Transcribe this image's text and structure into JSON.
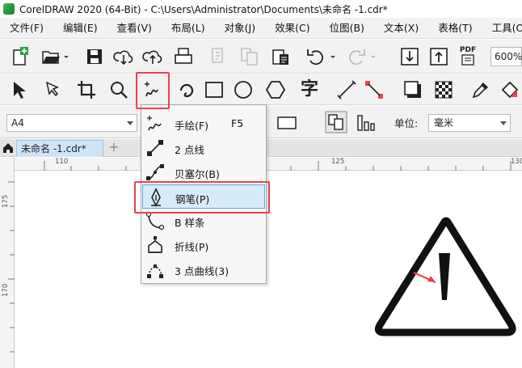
{
  "window": {
    "title": "CorelDRAW 2020 (64-Bit) - C:\\Users\\Administrator\\Documents\\未命名 -1.cdr*"
  },
  "menu": [
    "文件(F)",
    "编辑(E)",
    "查看(V)",
    "布局(L)",
    "对象(J)",
    "效果(C)",
    "位图(B)",
    "文本(X)",
    "表格(T)",
    "工具(O)"
  ],
  "toolbar": {
    "zoom": "600%",
    "pdf_label": "PDF"
  },
  "toolbox": {
    "text_tool_glyph": "字"
  },
  "property_bar": {
    "page_size": "A4",
    "unit_label": "单位:",
    "unit_value": "毫米"
  },
  "tabs": {
    "doc_tab": "未命名 -1.cdr*",
    "add_tab": "+"
  },
  "ruler": {
    "h_labels": [
      "110",
      "125",
      "130"
    ],
    "v_labels": [
      "175",
      "170"
    ]
  },
  "curve_flyout": {
    "items": [
      {
        "label": "手绘(F)",
        "shortcut": "F5",
        "icon": "freehand-icon"
      },
      {
        "label": "2 点线",
        "shortcut": "",
        "icon": "two-point-line-icon"
      },
      {
        "label": "贝塞尔(B)",
        "shortcut": "",
        "icon": "bezier-icon"
      },
      {
        "label": "钢笔(P)",
        "shortcut": "",
        "icon": "pen-icon",
        "active": true
      },
      {
        "label": "B 样条",
        "shortcut": "",
        "icon": "b-spline-icon"
      },
      {
        "label": "折线(P)",
        "shortcut": "",
        "icon": "polyline-icon"
      },
      {
        "label": "3 点曲线(3)",
        "shortcut": "",
        "icon": "three-point-curve-icon"
      }
    ]
  },
  "colors": {
    "highlight": "#e8414f",
    "active_item": "#d7ebfb",
    "accent_arrow": "#e8414f"
  }
}
